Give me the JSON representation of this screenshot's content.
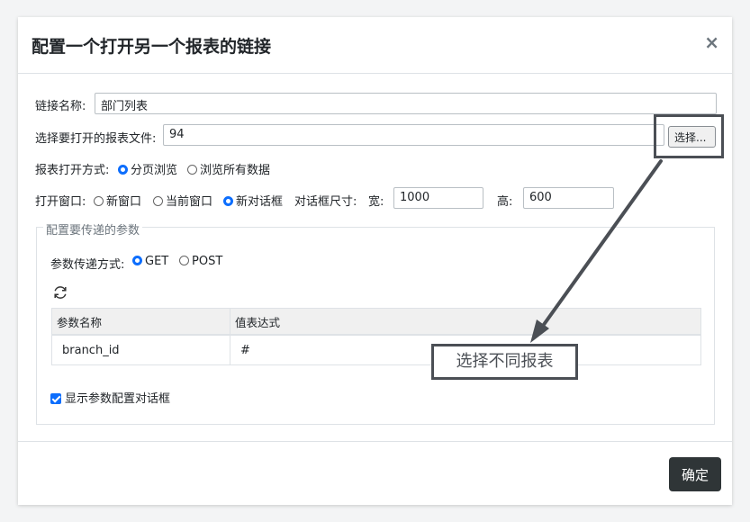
{
  "dialog": {
    "title": "配置一个打开另一个报表的链接",
    "close_label": "×",
    "ok_label": "确定"
  },
  "form": {
    "link_name_label": "链接名称:",
    "link_name_value": "部门列表",
    "report_file_label": "选择要打开的报表文件:",
    "report_file_value": "94",
    "select_button_label": "选择...",
    "open_mode_label": "报表打开方式:",
    "open_mode_options": [
      "分页浏览",
      "浏览所有数据"
    ],
    "open_mode_selected": "分页浏览",
    "window_label": "打开窗口:",
    "window_options": [
      "新窗口",
      "当前窗口",
      "新对话框"
    ],
    "window_selected": "新对话框",
    "dialog_size_label": "对话框尺寸:",
    "width_label": "宽:",
    "width_value": "1000",
    "height_label": "高:",
    "height_value": "600"
  },
  "params": {
    "legend": "配置要传递的参数",
    "method_label": "参数传递方式:",
    "method_options": [
      "GET",
      "POST"
    ],
    "method_selected": "GET",
    "refresh_icon": "refresh-icon",
    "columns": [
      "参数名称",
      "值表达式"
    ],
    "rows": [
      [
        "branch_id",
        "#"
      ]
    ],
    "show_dialog_label": "显示参数配置对话框",
    "show_dialog_checked": true
  },
  "annotation": {
    "callout_text": "选择不同报表",
    "color": "#4b4f55"
  },
  "colors": {
    "accent": "#0d6efd",
    "ok_button": "#2f3537"
  }
}
